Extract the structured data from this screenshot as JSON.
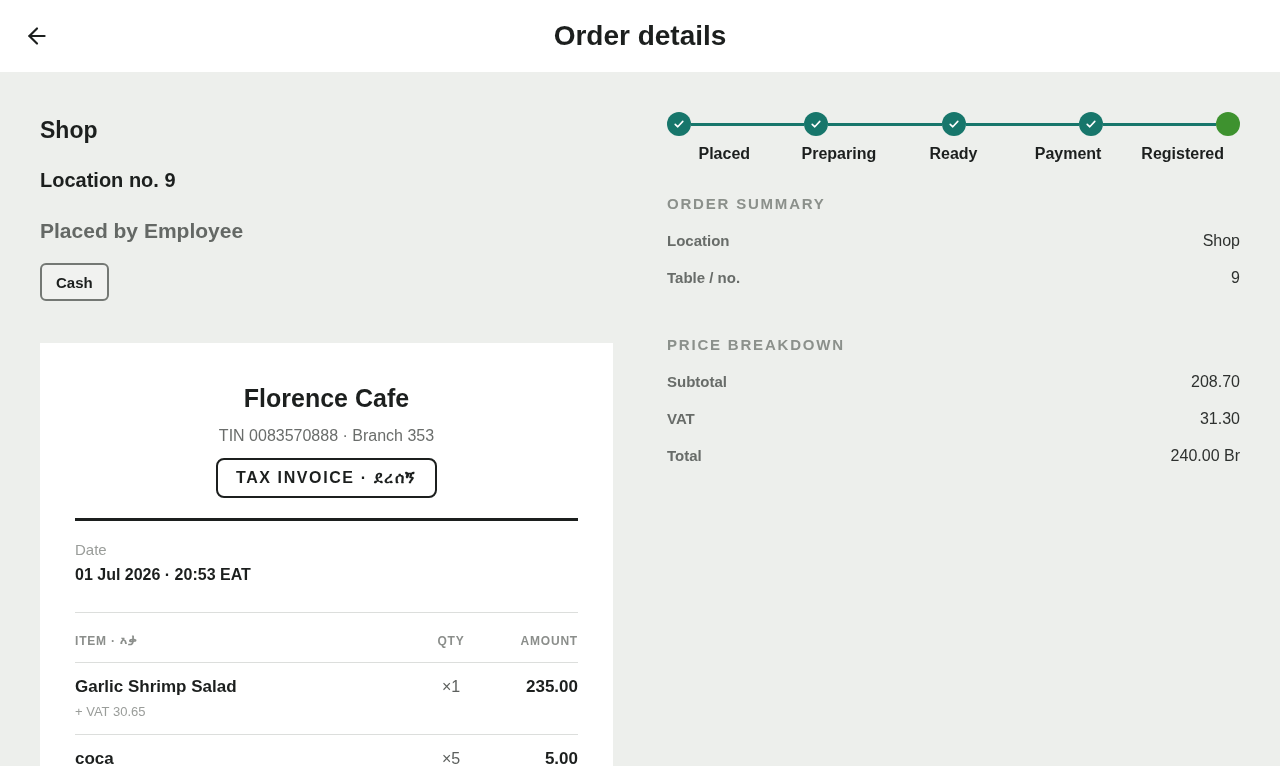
{
  "header": {
    "title": "Order details"
  },
  "order": {
    "location_title": "Shop",
    "location_number": "Location no. 9",
    "placed_by": "Placed by Employee",
    "payment_method": "Cash"
  },
  "receipt": {
    "business_name": "Florence Cafe",
    "tax_line": "TIN 0083570888 · Branch 353",
    "document_type": "TAX INVOICE · ደረሰኝ",
    "date_label": "Date",
    "date_value": "01 Jul 2026 · 20:53 EAT",
    "columns": [
      "ITEM · እቃ",
      "QTY",
      "AMOUNT"
    ],
    "items": [
      {
        "name": "Garlic Shrimp Salad",
        "vat": "+ VAT 30.65",
        "qty": "×1",
        "amount": "235.00"
      },
      {
        "name": "coca",
        "qty": "×5",
        "amount": "5.00"
      }
    ]
  },
  "progress": {
    "steps": [
      {
        "label": "Placed",
        "done": true
      },
      {
        "label": "Preparing",
        "done": true
      },
      {
        "label": "Ready",
        "done": true
      },
      {
        "label": "Payment",
        "done": true
      },
      {
        "label": "Registered",
        "done": false
      }
    ]
  },
  "order_summary": {
    "title": "ORDER SUMMARY",
    "rows": [
      {
        "label": "Location",
        "value": "Shop"
      },
      {
        "label": "Table / no.",
        "value": "9"
      }
    ]
  },
  "price_breakdown": {
    "title": "PRICE BREAKDOWN",
    "rows": [
      {
        "label": "Subtotal",
        "value": "208.70"
      },
      {
        "label": "VAT",
        "value": "31.30"
      },
      {
        "label": "Total",
        "value": "240.00 Br"
      }
    ]
  }
}
